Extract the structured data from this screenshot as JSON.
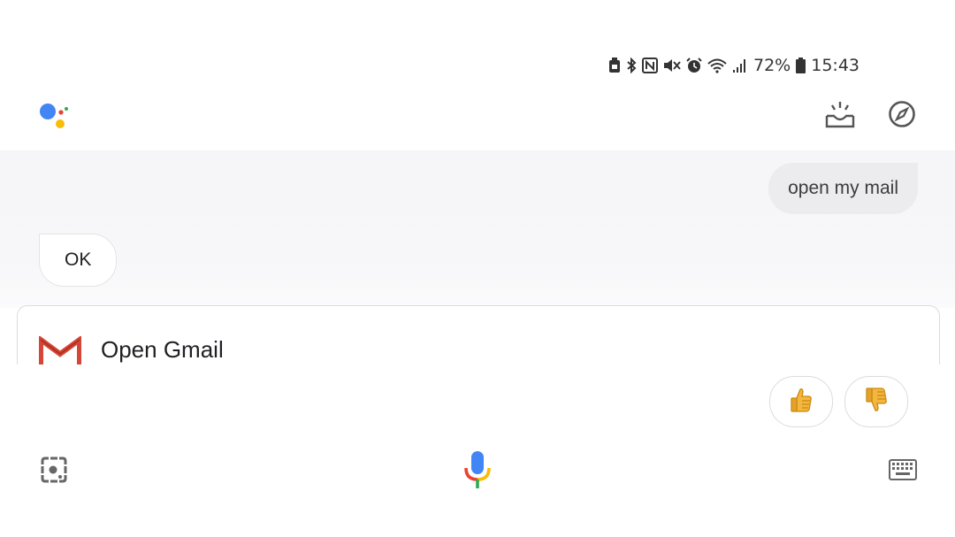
{
  "status_bar": {
    "battery_percent": "72%",
    "time": "15:43",
    "icons": [
      "nfc-tag-icon",
      "bluetooth-icon",
      "nfc-icon",
      "mute-icon",
      "alarm-icon",
      "wifi-icon",
      "signal-icon",
      "battery-icon"
    ]
  },
  "header": {
    "logo": "google-assistant-logo",
    "actions": [
      {
        "name": "updates",
        "icon": "updates-tray-icon"
      },
      {
        "name": "explore",
        "icon": "compass-icon"
      }
    ]
  },
  "conversation": {
    "user_message": "open my mail",
    "assistant_reply": "OK"
  },
  "card": {
    "app_icon": "gmail-icon",
    "title": "Open Gmail"
  },
  "feedback": {
    "positive_icon": "thumbs-up-icon",
    "negative_icon": "thumbs-down-icon"
  },
  "bottom_bar": {
    "left_icon": "lens-icon",
    "center_icon": "microphone-icon",
    "right_icon": "keyboard-icon"
  },
  "colors": {
    "google_blue": "#4285F4",
    "google_red": "#EA4335",
    "google_yellow": "#FBBC05",
    "google_green": "#34A853",
    "gmail_red": "#D44638"
  }
}
